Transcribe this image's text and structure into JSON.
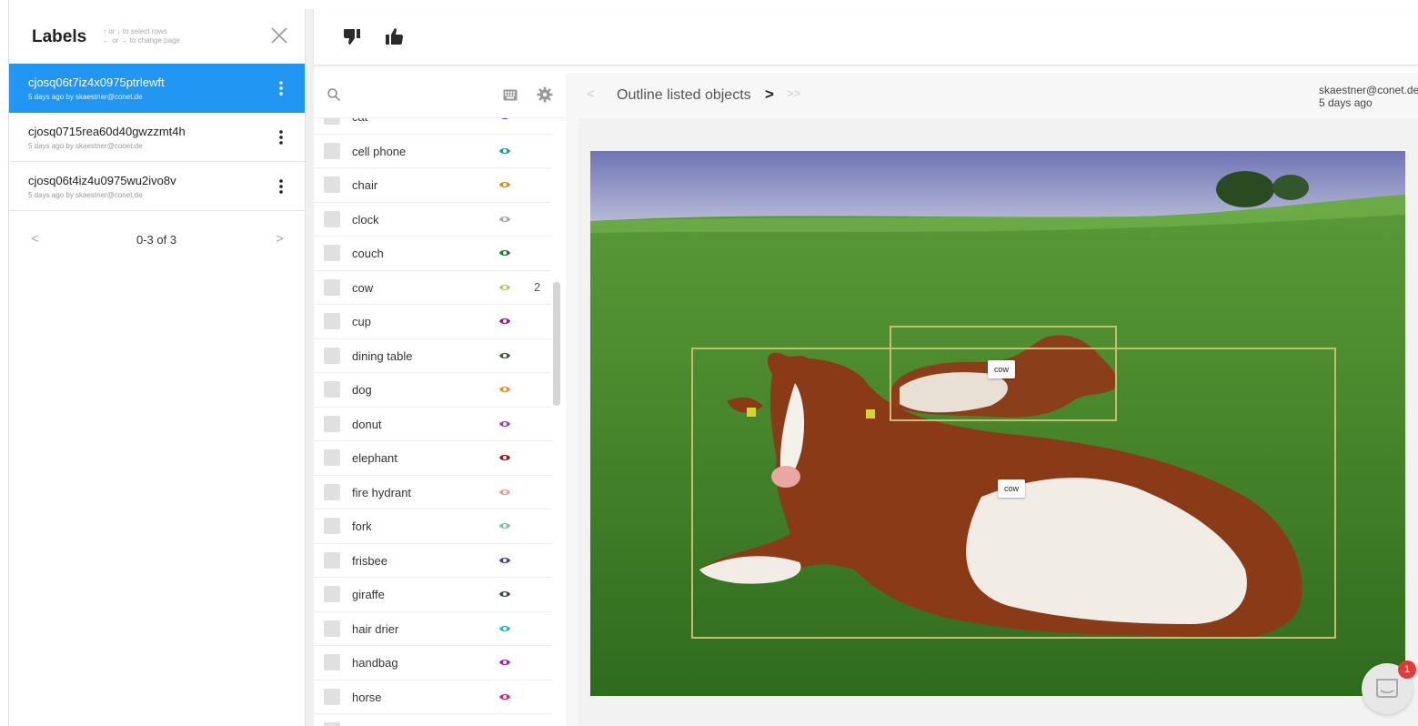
{
  "labels_panel": {
    "title": "Labels",
    "hint_line1": "↑ or ↓ to select rows",
    "hint_line2": "← or → to change page",
    "rows": [
      {
        "id": "cjosq06t7iz4x0975ptrlewft",
        "meta": "5 days ago by skaestner@conet.de",
        "active": true
      },
      {
        "id": "cjosq0715rea60d40gwzzmt4h",
        "meta": "5 days ago by skaestner@conet.de",
        "active": false
      },
      {
        "id": "cjosq06t4iz4u0975wu2ivo8v",
        "meta": "5 days ago by skaestner@conet.de",
        "active": false
      }
    ],
    "pager": {
      "text": "0-3 of 3",
      "prev": "<",
      "next": ">"
    }
  },
  "toolbar": {
    "thumbs_down_icon": "thumbs-down-icon",
    "thumbs_up_icon": "thumbs-up-icon"
  },
  "class_panel": {
    "classes": [
      {
        "name": "cat",
        "eye_color": "#3f3fb5",
        "count": ""
      },
      {
        "name": "cell phone",
        "eye_color": "#1a9d9d",
        "count": ""
      },
      {
        "name": "chair",
        "eye_color": "#c9911f",
        "count": ""
      },
      {
        "name": "clock",
        "eye_color": "#a7a7a7",
        "count": ""
      },
      {
        "name": "couch",
        "eye_color": "#1e7a2e",
        "count": ""
      },
      {
        "name": "cow",
        "eye_color": "#c9bc6e",
        "count": "2"
      },
      {
        "name": "cup",
        "eye_color": "#a3148a",
        "count": ""
      },
      {
        "name": "dining table",
        "eye_color": "#4a5b34",
        "count": ""
      },
      {
        "name": "dog",
        "eye_color": "#f08c1d",
        "count": ""
      },
      {
        "name": "donut",
        "eye_color": "#9b3fc9",
        "count": ""
      },
      {
        "name": "elephant",
        "eye_color": "#9e1212",
        "count": ""
      },
      {
        "name": "fire hydrant",
        "eye_color": "#f39b86",
        "count": ""
      },
      {
        "name": "fork",
        "eye_color": "#7fc29a",
        "count": ""
      },
      {
        "name": "frisbee",
        "eye_color": "#4b3e8c",
        "count": ""
      },
      {
        "name": "giraffe",
        "eye_color": "#2f4f4a",
        "count": ""
      },
      {
        "name": "hair drier",
        "eye_color": "#23bcd1",
        "count": ""
      },
      {
        "name": "handbag",
        "eye_color": "#a61fb3",
        "count": ""
      },
      {
        "name": "horse",
        "eye_color": "#e61e74",
        "count": ""
      },
      {
        "name": "",
        "eye_color": "#dddddd",
        "count": ""
      }
    ]
  },
  "task": {
    "prev": "<",
    "title": "Outline listed objects",
    "next": ">",
    "last": ">>",
    "user": "skaestner@conet.de",
    "date": "5 days ago"
  },
  "annotations": {
    "box_color": "#c9bc6e",
    "boxes": [
      {
        "label": "cow"
      },
      {
        "label": "cow"
      }
    ]
  },
  "chat": {
    "badge": "1"
  }
}
